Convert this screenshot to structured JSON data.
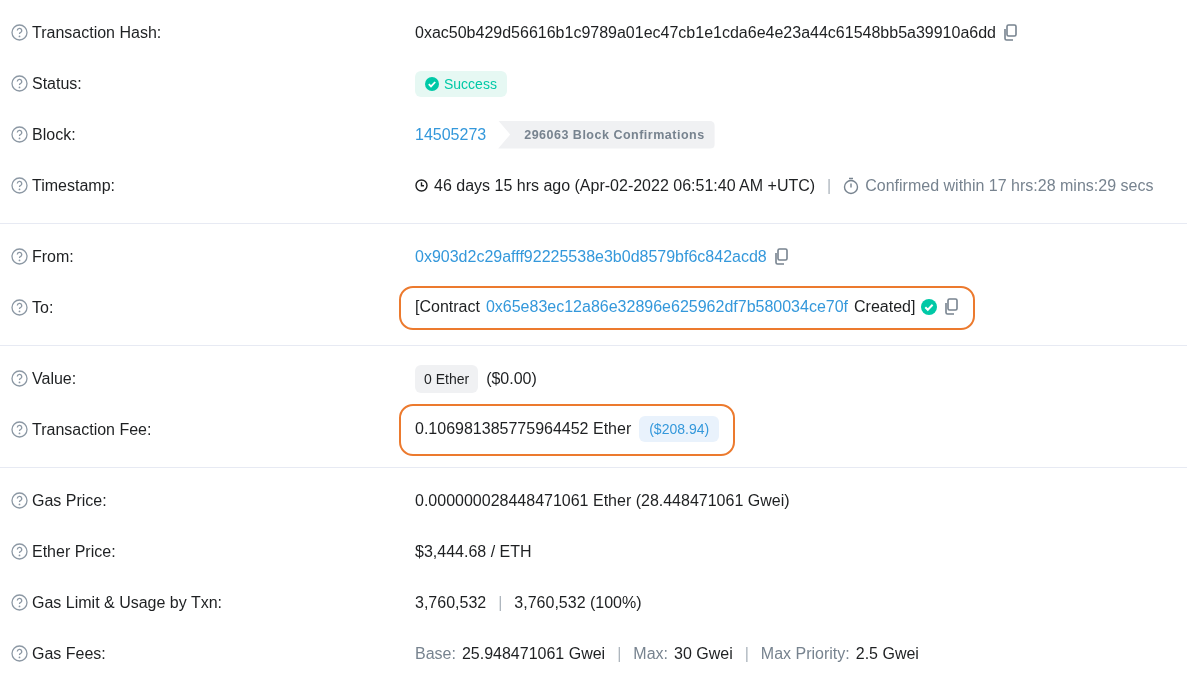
{
  "sections": [
    {
      "rows": [
        {
          "label": "Transaction Hash:",
          "highlighted": false,
          "parts": [
            {
              "kind": "text",
              "text": "0xac50b429d56616b1c9789a01ec47cb1e1cda6e4e23a44c61548bb5a39910a6dd"
            },
            {
              "kind": "copy"
            }
          ]
        },
        {
          "label": "Status:",
          "highlighted": false,
          "parts": [
            {
              "kind": "success",
              "text": "Success"
            }
          ]
        },
        {
          "label": "Block:",
          "highlighted": false,
          "parts": [
            {
              "kind": "link",
              "text": "14505273"
            },
            {
              "kind": "arrow-tag",
              "text": "296063 Block Confirmations"
            }
          ]
        },
        {
          "label": "Timestamp:",
          "highlighted": false,
          "parts": [
            {
              "kind": "clock"
            },
            {
              "kind": "text",
              "text": "46 days 15 hrs ago (Apr-02-2022 06:51:40 AM +UTC)"
            },
            {
              "kind": "sep",
              "text": "|"
            },
            {
              "kind": "timer"
            },
            {
              "kind": "muted",
              "text": "Confirmed within 17 hrs:28 mins:29 secs"
            }
          ]
        }
      ]
    },
    {
      "rows": [
        {
          "label": "From:",
          "highlighted": false,
          "parts": [
            {
              "kind": "link",
              "text": "0x903d2c29afff92225538e3b0d8579bf6c842acd8"
            },
            {
              "kind": "copy"
            }
          ]
        },
        {
          "label": "To:",
          "highlighted": true,
          "parts": [
            {
              "kind": "text",
              "text": "[Contract"
            },
            {
              "kind": "link",
              "text": "0x65e83ec12a86e32896e625962df7b580034ce70f"
            },
            {
              "kind": "text",
              "text": "Created]"
            },
            {
              "kind": "check"
            },
            {
              "kind": "copy"
            }
          ]
        }
      ]
    },
    {
      "rows": [
        {
          "label": "Value:",
          "highlighted": false,
          "parts": [
            {
              "kind": "tag",
              "text": "0 Ether"
            },
            {
              "kind": "text",
              "text": "($0.00)"
            }
          ]
        },
        {
          "label": "Transaction Fee:",
          "highlighted": true,
          "parts": [
            {
              "kind": "text",
              "text": "0.106981385775964452 Ether"
            },
            {
              "kind": "usd-tag",
              "text": "($208.94)"
            }
          ]
        }
      ]
    },
    {
      "rows": [
        {
          "label": "Gas Price:",
          "highlighted": false,
          "parts": [
            {
              "kind": "text",
              "text": "0.000000028448471061 Ether (28.448471061 Gwei)"
            }
          ]
        },
        {
          "label": "Ether Price:",
          "highlighted": false,
          "parts": [
            {
              "kind": "text",
              "text": "$3,444.68 / ETH"
            }
          ]
        },
        {
          "label": "Gas Limit & Usage by Txn:",
          "highlighted": false,
          "parts": [
            {
              "kind": "text",
              "text": "3,760,532"
            },
            {
              "kind": "sep",
              "text": "|"
            },
            {
              "kind": "text",
              "text": "3,760,532 (100%)"
            }
          ]
        },
        {
          "label": "Gas Fees:",
          "highlighted": false,
          "parts": [
            {
              "kind": "muted",
              "text": "Base:"
            },
            {
              "kind": "text",
              "text": "25.948471061 Gwei"
            },
            {
              "kind": "sep",
              "text": "|"
            },
            {
              "kind": "muted",
              "text": "Max:"
            },
            {
              "kind": "text",
              "text": "30 Gwei"
            },
            {
              "kind": "sep",
              "text": "|"
            },
            {
              "kind": "muted",
              "text": "Max Priority:"
            },
            {
              "kind": "text",
              "text": "2.5 Gwei"
            }
          ]
        }
      ]
    }
  ]
}
